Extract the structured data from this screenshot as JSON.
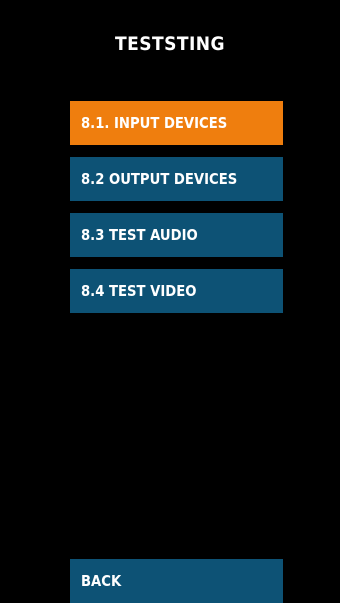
{
  "screen": {
    "title": "TESTSTING"
  },
  "menu": {
    "items": [
      {
        "label": "8.1. INPUT DEVICES",
        "active": true
      },
      {
        "label": "8.2 OUTPUT DEVICES",
        "active": false
      },
      {
        "label": "8.3 TEST AUDIO",
        "active": false
      },
      {
        "label": "8.4 TEST VIDEO",
        "active": false
      }
    ]
  },
  "footer": {
    "back_label": "BACK"
  },
  "colors": {
    "background": "#000000",
    "item": "#0d5275",
    "active_item": "#ef7e0e",
    "text": "#ffffff"
  }
}
